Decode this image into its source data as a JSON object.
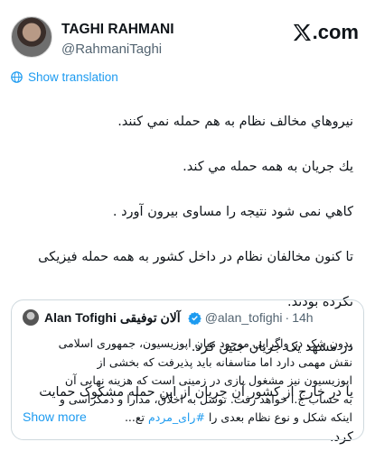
{
  "author": {
    "name": "TAGHI RAHMANI",
    "handle": "@RahmaniTaghi"
  },
  "brand": {
    "logo_text": ".com"
  },
  "translate_label": "Show translation",
  "tweet_lines": [
    "نيروهاي مخالف نظام به هم حمله نمي كنند.",
    "يك جريان به همه حمله مي كند.",
    "كاهي نمی شود نتیجه را مساوی بیرون آورد .",
    "تا کنون مخالفان نظام در داخل کشور به همه حمله فیزیکی",
    "نکرده بودند.",
    "در مشهد یک جریان جنین کرد.",
    "یا در خارج از کشور آن جریان از این حمله مشکوک حمایت",
    "کرد."
  ],
  "quote": {
    "name": "Alan Tofighi",
    "name_fa": "آلان توفیقی",
    "handle": "@alan_tofighi",
    "time": "14h",
    "separator": "·",
    "lines": [
      "بدون شک در واگرایی موجود میان اپوزیسیون، جمهوری اسلامی",
      "نقش مهمی دارد اما متاسفانه باید پذیرفت که بخشی از",
      "اپوزیسیون نیز مشغول بازی در زمینی است که هزینه نهایی آن",
      "به حساب ج.ا خواهد رفت. توسل به اخلاق، مدارا و دمکراسی و"
    ],
    "last_line_prefix": "اینکه شکل و نوع نظام بعدی را",
    "hashtag": "#رای_مردم",
    "last_line_suffix": "تع...",
    "show_more": "Show more"
  }
}
